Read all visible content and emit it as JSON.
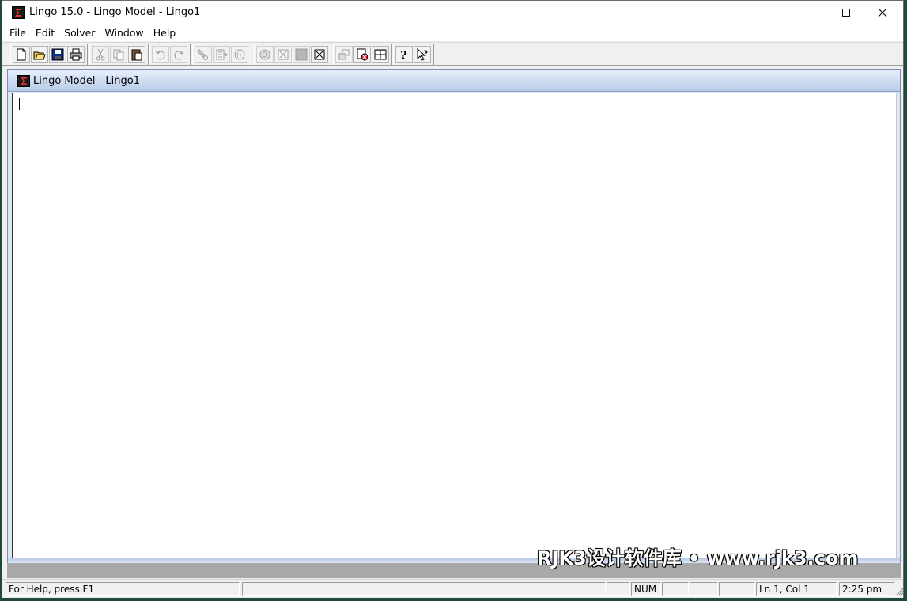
{
  "app": {
    "title": "Lingo 15.0 - Lingo Model - Lingo1",
    "icon": "lingo-sigma-icon"
  },
  "menu": [
    "File",
    "Edit",
    "Solver",
    "Window",
    "Help"
  ],
  "toolbar": {
    "groups": [
      [
        "new-icon",
        "open-icon",
        "save-icon",
        "print-icon"
      ],
      [
        "cut-icon",
        "copy-icon",
        "paste-icon"
      ],
      [
        "undo-icon",
        "redo-icon"
      ],
      [
        "find-icon",
        "go-to-line-icon",
        "match-parenthesis-icon"
      ],
      [
        "solve-icon",
        "solution-icon",
        "options-icon",
        "close-all-icon"
      ],
      [
        "send-to-back-icon",
        "close-window-icon",
        "tile-icon"
      ],
      [
        "help-icon",
        "context-help-icon"
      ]
    ]
  },
  "child_window": {
    "title": "Lingo Model - Lingo1",
    "content": ""
  },
  "status": {
    "help": "For Help, press F1",
    "num": "NUM",
    "position": "Ln 1, Col 1",
    "time": "2:25 pm"
  },
  "watermark": "RJK3设计软件库 • www.rjk3.com",
  "colors": {
    "child_title_gradient_top": "#e9f0fb",
    "child_title_gradient_bottom": "#b7cbe8",
    "mdi_background": "#a8a8a8"
  }
}
